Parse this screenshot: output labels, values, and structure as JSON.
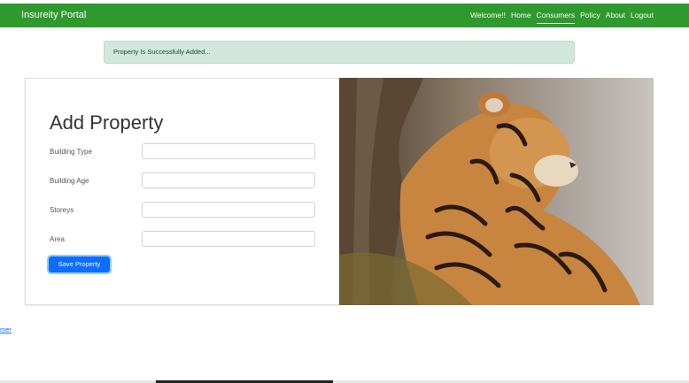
{
  "navbar": {
    "brand": "Insureity Portal",
    "links": [
      "Welcome!!",
      "Home",
      "Consumers",
      "Policy",
      "About",
      "Logout"
    ],
    "active": "Consumers",
    "color": "#2e9a2e"
  },
  "alert": {
    "message": "Property Is Successfully Added..."
  },
  "form": {
    "title": "Add Property",
    "fields": [
      {
        "label": "Building Type",
        "value": ""
      },
      {
        "label": "Building Age",
        "value": ""
      },
      {
        "label": "Storeys",
        "value": ""
      },
      {
        "label": "Area",
        "value": ""
      }
    ],
    "submit_label": "Save Property"
  },
  "image": {
    "subject": "tiger-photo"
  },
  "footer": {
    "link_text": "mer"
  }
}
